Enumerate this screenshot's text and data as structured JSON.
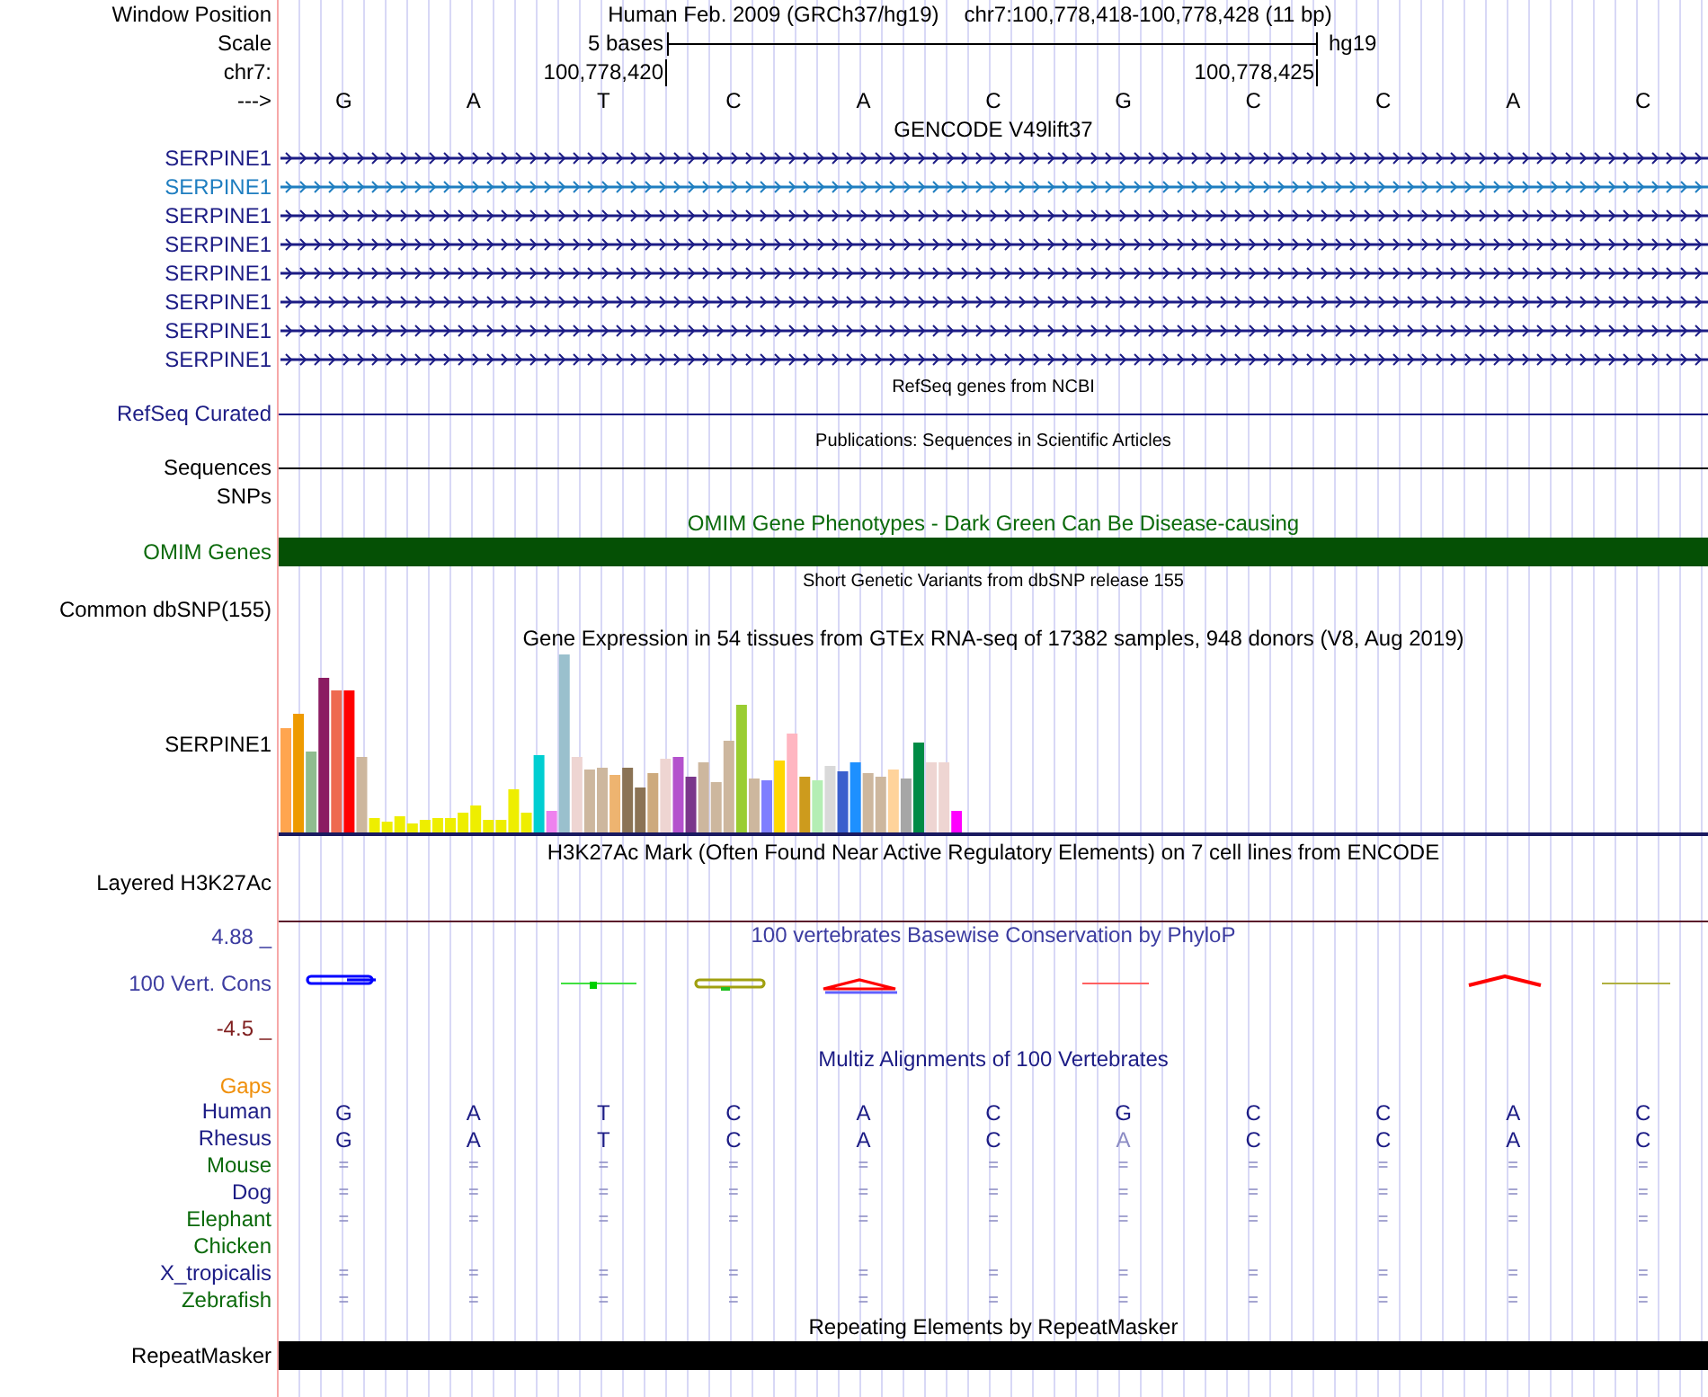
{
  "header": {
    "position_label": "Window Position",
    "assembly_title": "Human Feb. 2009 (GRCh37/hg19)",
    "position": "chr7:100,778,418-100,778,428 (11 bp)",
    "scale_label": "Scale",
    "scale_text": "5 bases",
    "assembly": "hg19",
    "chrom_label": "chr7:",
    "ticks": [
      "100,778,420",
      "100,778,425"
    ],
    "strand_label": "--->",
    "bases": [
      "G",
      "A",
      "T",
      "C",
      "A",
      "C",
      "G",
      "C",
      "C",
      "A",
      "C"
    ]
  },
  "tracks": [
    {
      "kind": "genes",
      "title": {
        "text": "GENCODE V49lift37",
        "color": "#000000"
      },
      "rows": [
        {
          "label": "SERPINE1",
          "color": "#1c1c85"
        },
        {
          "label": "SERPINE1",
          "color": "#1f7ec0"
        },
        {
          "label": "SERPINE1",
          "color": "#1c1c85"
        },
        {
          "label": "SERPINE1",
          "color": "#1c1c85"
        },
        {
          "label": "SERPINE1",
          "color": "#1c1c85"
        },
        {
          "label": "SERPINE1",
          "color": "#1c1c85"
        },
        {
          "label": "SERPINE1",
          "color": "#1c1c85"
        },
        {
          "label": "SERPINE1",
          "color": "#1c1c85"
        }
      ]
    },
    {
      "kind": "line",
      "title": {
        "text": "RefSeq genes from NCBI",
        "color": "#000000"
      },
      "label": {
        "text": "RefSeq Curated",
        "color": "#1c1c85"
      },
      "color": "#0c0c80"
    },
    {
      "kind": "line",
      "title": {
        "text": "Publications: Sequences in Scientific Articles",
        "color": "#000000"
      },
      "label": {
        "text": "Sequences",
        "color": "#000000"
      },
      "color": "#000000"
    },
    {
      "kind": "empty",
      "label": {
        "text": "SNPs",
        "color": "#000000"
      }
    },
    {
      "kind": "bar",
      "title": {
        "text": "OMIM Gene Phenotypes - Dark Green Can Be Disease-causing",
        "color": "#0b6a0b"
      },
      "label": {
        "text": "OMIM Genes",
        "color": "#0b6a0b"
      },
      "color": "#055005"
    },
    {
      "kind": "empty",
      "title": {
        "text": "Short Genetic Variants from dbSNP release 155",
        "color": "#000000"
      },
      "label": {
        "text": "Common dbSNP(155)",
        "color": "#000000"
      }
    },
    {
      "kind": "expression",
      "title": {
        "text": "Gene Expression in 54 tissues from GTEx RNA-seq of 17382 samples, 948 donors (V8, Aug 2019)",
        "color": "#000000"
      },
      "label": {
        "text": "SERPINE1",
        "color": "#000000"
      }
    },
    {
      "kind": "layered",
      "title": {
        "text": "H3K27Ac Mark (Often Found Near Active Regulatory Elements) on 7 cell lines from ENCODE",
        "color": "#000000"
      },
      "label": {
        "text": "Layered H3K27Ac",
        "color": "#000000"
      }
    },
    {
      "kind": "conservation",
      "title": {
        "text": "100 vertebrates Basewise Conservation by PhyloP",
        "color": "#3c3ca0"
      },
      "label": {
        "text": "100 Vert. Cons",
        "color": "#3c3ca0"
      },
      "scale_top": "4.88 _",
      "scale_bottom": "-4.5 _"
    },
    {
      "kind": "multiz",
      "title": {
        "text": "Multiz Alignments of 100 Vertebrates",
        "color": "#1c1c85"
      },
      "label": {
        "text": "Gaps",
        "color": "#f0900c"
      },
      "species": [
        {
          "name": "Human",
          "color": "#1c1c85",
          "bases": [
            {
              "text": "G",
              "faded": false
            },
            {
              "text": "A",
              "faded": false
            },
            {
              "text": "T",
              "faded": false
            },
            {
              "text": "C",
              "faded": false
            },
            {
              "text": "A",
              "faded": false
            },
            {
              "text": "C",
              "faded": false
            },
            {
              "text": "G",
              "faded": false
            },
            {
              "text": "C",
              "faded": false
            },
            {
              "text": "C",
              "faded": false
            },
            {
              "text": "A",
              "faded": false
            },
            {
              "text": "C",
              "faded": false
            }
          ]
        },
        {
          "name": "Rhesus",
          "color": "#1c1c85",
          "bases": [
            {
              "text": "G",
              "faded": false
            },
            {
              "text": "A",
              "faded": false
            },
            {
              "text": "T",
              "faded": false
            },
            {
              "text": "C",
              "faded": false
            },
            {
              "text": "A",
              "faded": false
            },
            {
              "text": "C",
              "faded": false
            },
            {
              "text": "A",
              "faded": true
            },
            {
              "text": "C",
              "faded": false
            },
            {
              "text": "C",
              "faded": false
            },
            {
              "text": "A",
              "faded": false
            },
            {
              "text": "C",
              "faded": false
            }
          ]
        },
        {
          "name": "Mouse",
          "color": "#0b6a0b",
          "bases": [
            {
              "text": "=",
              "faded": true
            },
            {
              "text": "=",
              "faded": true
            },
            {
              "text": "=",
              "faded": true
            },
            {
              "text": "=",
              "faded": true
            },
            {
              "text": "=",
              "faded": true
            },
            {
              "text": "=",
              "faded": true
            },
            {
              "text": "=",
              "faded": true
            },
            {
              "text": "=",
              "faded": true
            },
            {
              "text": "=",
              "faded": true
            },
            {
              "text": "=",
              "faded": true
            },
            {
              "text": "=",
              "faded": true
            }
          ]
        },
        {
          "name": "Dog",
          "color": "#1c1c85",
          "bases": [
            {
              "text": "=",
              "faded": true
            },
            {
              "text": "=",
              "faded": true
            },
            {
              "text": "=",
              "faded": true
            },
            {
              "text": "=",
              "faded": true
            },
            {
              "text": "=",
              "faded": true
            },
            {
              "text": "=",
              "faded": true
            },
            {
              "text": "=",
              "faded": true
            },
            {
              "text": "=",
              "faded": true
            },
            {
              "text": "=",
              "faded": true
            },
            {
              "text": "=",
              "faded": true
            },
            {
              "text": "=",
              "faded": true
            }
          ]
        },
        {
          "name": "Elephant",
          "color": "#0b6a0b",
          "bases": [
            {
              "text": "=",
              "faded": true
            },
            {
              "text": "=",
              "faded": true
            },
            {
              "text": "=",
              "faded": true
            },
            {
              "text": "=",
              "faded": true
            },
            {
              "text": "=",
              "faded": true
            },
            {
              "text": "=",
              "faded": true
            },
            {
              "text": "=",
              "faded": true
            },
            {
              "text": "=",
              "faded": true
            },
            {
              "text": "=",
              "faded": true
            },
            {
              "text": "=",
              "faded": true
            },
            {
              "text": "=",
              "faded": true
            }
          ]
        },
        {
          "name": "Chicken",
          "color": "#0b6a0b"
        },
        {
          "name": "X_tropicalis",
          "color": "#1c1c85",
          "bases": [
            {
              "text": "=",
              "faded": true
            },
            {
              "text": "=",
              "faded": true
            },
            {
              "text": "=",
              "faded": true
            },
            {
              "text": "=",
              "faded": true
            },
            {
              "text": "=",
              "faded": true
            },
            {
              "text": "=",
              "faded": true
            },
            {
              "text": "=",
              "faded": true
            },
            {
              "text": "=",
              "faded": true
            },
            {
              "text": "=",
              "faded": true
            },
            {
              "text": "=",
              "faded": true
            },
            {
              "text": "=",
              "faded": true
            }
          ]
        },
        {
          "name": "Zebrafish",
          "color": "#0b6a0b",
          "bases": [
            {
              "text": "=",
              "faded": true
            },
            {
              "text": "=",
              "faded": true
            },
            {
              "text": "=",
              "faded": true
            },
            {
              "text": "=",
              "faded": true
            },
            {
              "text": "=",
              "faded": true
            },
            {
              "text": "=",
              "faded": true
            },
            {
              "text": "=",
              "faded": true
            },
            {
              "text": "=",
              "faded": true
            },
            {
              "text": "=",
              "faded": true
            },
            {
              "text": "=",
              "faded": true
            },
            {
              "text": "=",
              "faded": true
            }
          ]
        }
      ]
    },
    {
      "kind": "bar",
      "title": {
        "text": "Repeating Elements by RepeatMasker",
        "color": "#000000"
      },
      "label": {
        "text": "RepeatMasker",
        "color": "#000000"
      },
      "color": "#000000"
    }
  ]
}
